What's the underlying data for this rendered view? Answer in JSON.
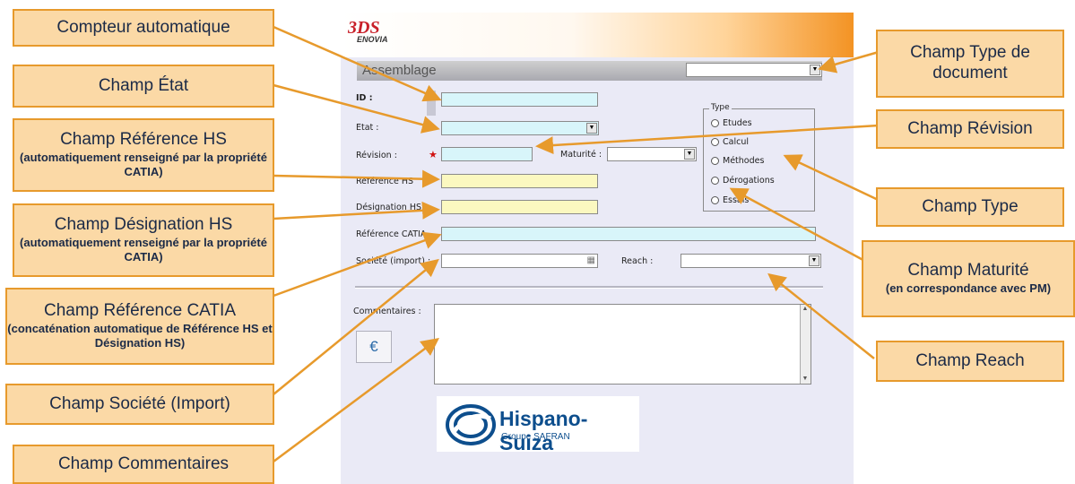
{
  "app": {
    "brand_ds": "3DS",
    "brand_name": "ENOVIA"
  },
  "form": {
    "section_title": "Assemblage",
    "fields": {
      "id_label": "ID :",
      "etat_label": "Etat :",
      "revision_label": "Révision :",
      "maturite_label": "Maturité :",
      "reference_hs_label": "Référence HS",
      "designation_hs_label": "Désignation HS",
      "reference_catia_label": "Référence CATIA",
      "societe_label": "Société (import) :",
      "reach_label": "Reach :",
      "commentaires_label": "Commentaires :"
    },
    "type_group": {
      "legend": "Type",
      "options": [
        "Etudes",
        "Calcul",
        "Méthodes",
        "Dérogations",
        "Essais"
      ]
    },
    "logo": {
      "name": "Hispano-Suiza",
      "subtitle": "Groupe SAFRAN"
    }
  },
  "callouts": {
    "compteur": {
      "main": "Compteur automatique"
    },
    "etat": {
      "main": "Champ État"
    },
    "ref_hs": {
      "main": "Champ Référence  HS",
      "sub": "(automatiquement renseigné par la propriété CATIA)"
    },
    "des_hs": {
      "main": "Champ Désignation HS",
      "sub": "(automatiquement renseigné par la propriété CATIA)"
    },
    "ref_catia": {
      "main": "Champ Référence CATIA",
      "sub": "(concaténation automatique de Référence HS et Désignation HS)"
    },
    "societe": {
      "main": "Champ Société (Import)"
    },
    "commentaires": {
      "main": "Champ Commentaires"
    },
    "type_doc": {
      "main": "Champ Type de document"
    },
    "revision": {
      "main": "Champ Révision"
    },
    "type": {
      "main": "Champ Type"
    },
    "maturite": {
      "main": "Champ Maturité",
      "sub": "(en correspondance avec PM)"
    },
    "reach": {
      "main": "Champ Reach"
    }
  },
  "colors": {
    "accent": "#e79a2c",
    "callout_bg": "#fbd9a6",
    "callout_text": "#1b2a47",
    "logo_blue": "#0d4e8d"
  }
}
